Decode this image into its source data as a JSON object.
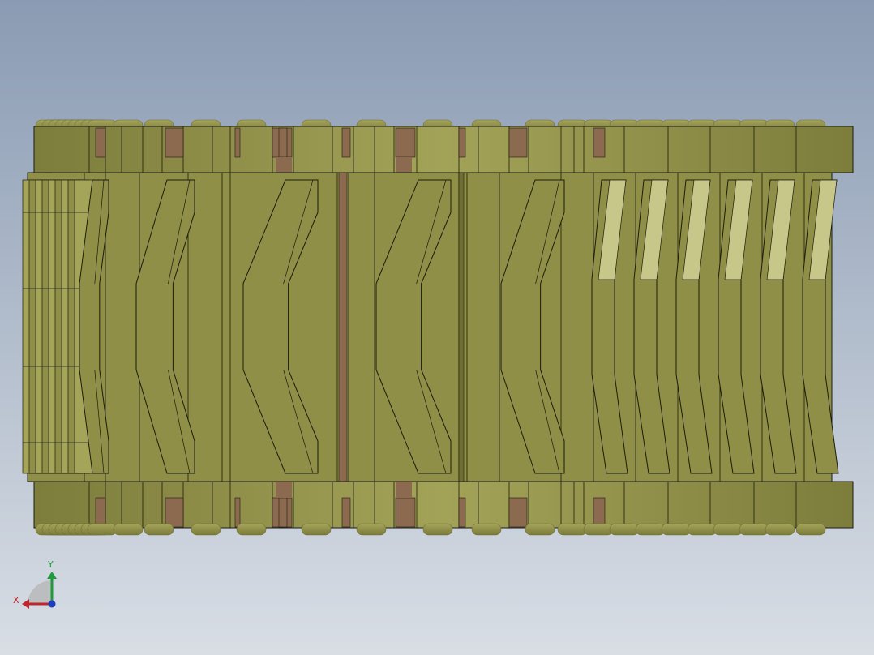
{
  "viewport": {
    "background_top": "#8a9bb3",
    "background_bottom": "#d9dee5"
  },
  "model": {
    "body_color": "#8f8f47",
    "body_light": "#a5a55a",
    "body_dark": "#6f6f35",
    "edge_color": "#1c1c10",
    "rubber_color": "#8c6a4f",
    "segment_light": "#c7c78a"
  },
  "triad": {
    "x_label": "X",
    "y_label": "Y",
    "x_color": "#c0262d",
    "y_color": "#1f9a3c",
    "z_color": "#1f3fb8"
  }
}
